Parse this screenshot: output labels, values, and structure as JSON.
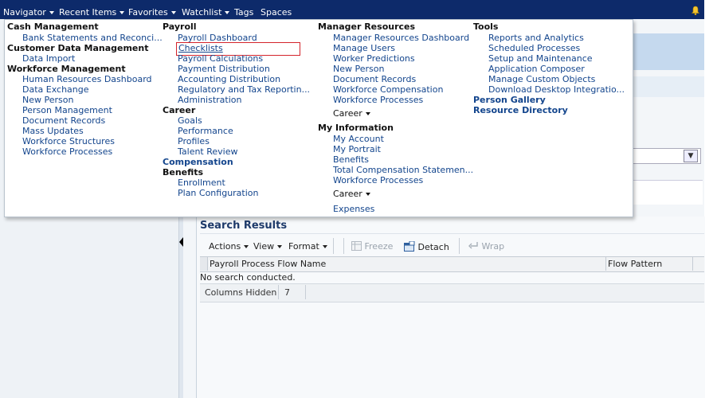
{
  "topbar": {
    "items": [
      "Navigator",
      "Recent Items",
      "Favorites",
      "Watchlist",
      "Tags",
      "Spaces"
    ],
    "bell_icon": "notification-bell-icon"
  },
  "navigator": {
    "cash_management": {
      "title": "Cash Management",
      "items": [
        "Bank Statements and Reconci..."
      ]
    },
    "customer_data_management": {
      "title": "Customer Data Management",
      "items": [
        "Data Import"
      ]
    },
    "workforce_management": {
      "title": "Workforce Management",
      "items": [
        "Human Resources Dashboard",
        "Data Exchange",
        "New Person",
        "Person Management",
        "Document Records",
        "Mass Updates",
        "Workforce Structures",
        "Workforce Processes"
      ]
    },
    "payroll": {
      "title": "Payroll",
      "items": [
        "Payroll Dashboard",
        "Checklists",
        "Payroll Calculations",
        "Payment Distribution",
        "Accounting Distribution",
        "Regulatory and Tax Reportin...",
        "Administration"
      ]
    },
    "career": {
      "title": "Career",
      "items": [
        "Goals",
        "Performance",
        "Profiles",
        "Talent Review"
      ]
    },
    "compensation": {
      "title": "Compensation"
    },
    "benefits": {
      "title": "Benefits",
      "items": [
        "Enrollment",
        "Plan Configuration"
      ]
    },
    "manager_resources": {
      "title": "Manager Resources",
      "items": [
        "Manager Resources Dashboard",
        "Manage Users",
        "Worker Predictions",
        "New Person",
        "Document Records",
        "Workforce Compensation",
        "Workforce Processes"
      ],
      "career_menu": "Career"
    },
    "my_information": {
      "title": "My Information",
      "items": [
        "My Account",
        "My Portrait",
        "Benefits",
        "Total Compensation Statemen...",
        "Workforce Processes"
      ],
      "career_menu": "Career",
      "expenses": "Expenses"
    },
    "tools": {
      "title": "Tools",
      "items": [
        "Reports and Analytics",
        "Scheduled Processes",
        "Setup and Maintenance",
        "Application Composer",
        "Manage Custom Objects",
        "Download Desktop Integratio..."
      ]
    },
    "person_gallery": {
      "title": "Person Gallery"
    },
    "resource_directory": {
      "title": "Resource Directory"
    }
  },
  "results": {
    "title": "Search Results",
    "toolbar": {
      "actions": "Actions",
      "view": "View",
      "format": "Format",
      "freeze": "Freeze",
      "detach": "Detach",
      "wrap": "Wrap"
    },
    "columns": [
      "Payroll Process Flow Name",
      "Flow Pattern"
    ],
    "empty_message": "No search conducted.",
    "columns_hidden_label": "Columns Hidden",
    "columns_hidden_count": "7"
  },
  "colors": {
    "topbar": "#0d2a6a",
    "link": "#13458d",
    "highlight_border": "#d4232b"
  }
}
